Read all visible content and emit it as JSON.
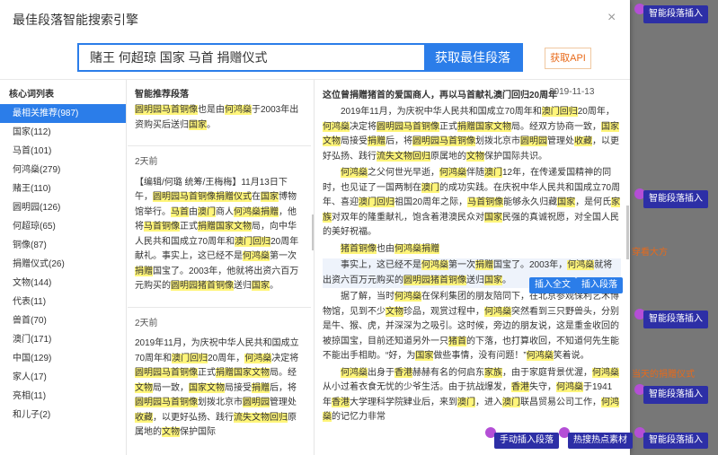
{
  "modal": {
    "title": "最佳段落智能搜索引擎",
    "close_icon": "×",
    "search_value": "赌王 何超琼 国家 马首 捐赠仪式",
    "search_button": "获取最佳段落",
    "api_button": "获取API"
  },
  "left": {
    "header": "核心词列表",
    "items": [
      "最相关推荐(987)",
      "国家(112)",
      "马首(101)",
      "何鸿燊(279)",
      "赌王(110)",
      "圆明园(126)",
      "何超琼(65)",
      "铜像(87)",
      "捐赠仪式(26)",
      "文物(144)",
      "代表(11)",
      "兽首(70)",
      "澳门(171)",
      "中国(129)",
      "家人(17)",
      "亮相(11)",
      "和儿子(2)"
    ]
  },
  "middle": {
    "header": "智能推荐段落",
    "card1_tail": "圆明园马首铜像也是由何鸿燊于2003年出资购买后送归国家。",
    "card2_time": "2天前",
    "card2_text": "【编辑/何璐 统筹/王梅梅】11月13日下午，圆明园马首铜像捐赠仪式在国家博物馆举行。马首由澳门商人何鸿燊捐赠，他将马首铜像正式捐赠国家文物局，向中华人民共和国成立70周年和澳门回归20周年献礼。事实上，这已经不是何鸿燊第一次捐赠国宝了。2003年，他就将出资六百万元购买的圆明园猪首铜像送归国家。",
    "card3_time": "2天前",
    "card3_text": "2019年11月，为庆祝中华人民共和国成立70周年和澳门回归20周年，何鸿燊决定将圆明园马首铜像正式捐赠国家文物局。经文物局一致，国家文物局接受捐赠后，将圆明园马首铜像划拨北京市圆明园管理处收藏，以更好弘扬、践行流失文物回归原属地的文物保护国际"
  },
  "right": {
    "article_title": "这位曾捐赠猪首的爱国商人，再以马首献礼澳门回归20周年",
    "article_date": "2019-11-13",
    "p1": "2019年11月，为庆祝中华人民共和国成立70周年和澳门回归20周年，何鸿燊决定将圆明园马首铜像正式捐赠国家文物局。经双方协商一致，国家文物局接受捐赠后，将圆明园马首铜像划拨北京市圆明园管理处收藏，以更好弘扬、践行流失文物回归原属地的文物保护国际共识。",
    "p2": "何鸿燊之父何世光早逝，何鸿燊伴随澳门12年，在传递爱国精神的同时，也见证了一国两制在澳门的成功实践。在庆祝中华人民共和国成立70周年、喜迎澳门回归祖国20周年之际，马首铜像能够永久归藏国家，是何氏家族对双年的隆重献礼，饱含着港澳民众对国家民强的真诚祝愿，对全国人民的美好祝福。",
    "p3": "猪首铜像也由何鸿燊捐赠",
    "p4": "事实上，这已经不是何鸿燊第一次捐赠国宝了。2003年，何鸿燊就将出资六百万元购买的圆明园猪首铜像送归国家。",
    "p5": "据了解，当时何鸿燊在保利集团的朋友陪同下，在北京参观保利艺术博物馆，见到不少文物珍品，观赏过程中，何鸿燊突然看到三只野兽头，分别是牛、猴、虎，并深深为之吸引。这时候，旁边的朋友说，这是重金收回的被掠国宝，目前还知道另外一只猪首的下落，也打算收回，不知道何先生能不能出手相助。“好，为国家做些事情，没有问题！”何鸿燊笑着说。",
    "p6": "何鸿燊出身于香港赫赫有名的何启东家族，由于家庭背景优渥，何鸿燊从小过着衣食无忧的少爷生活。由于抗战爆发，香港失守，何鸿燊于1941年香港大学理科学院肄业后，来到澳门，进入澳门联昌贸易公司工作，何鸿燊的记忆力非常",
    "insert_full": "插入全文",
    "insert_para": "插入段落"
  },
  "background": {
    "side_btn1": "智能段落插入",
    "side_btn2": "智能段落插入",
    "side_btn3": "智能段落插入",
    "side_btn4": "智能段落插入",
    "side_tag1": "穿看大方",
    "side_tag2": "当天的捐赠仪式",
    "bottom_btn1": "手动插入段落",
    "bottom_btn2": "热搜热点素材",
    "bottom_btn3": "智能段落插入"
  }
}
